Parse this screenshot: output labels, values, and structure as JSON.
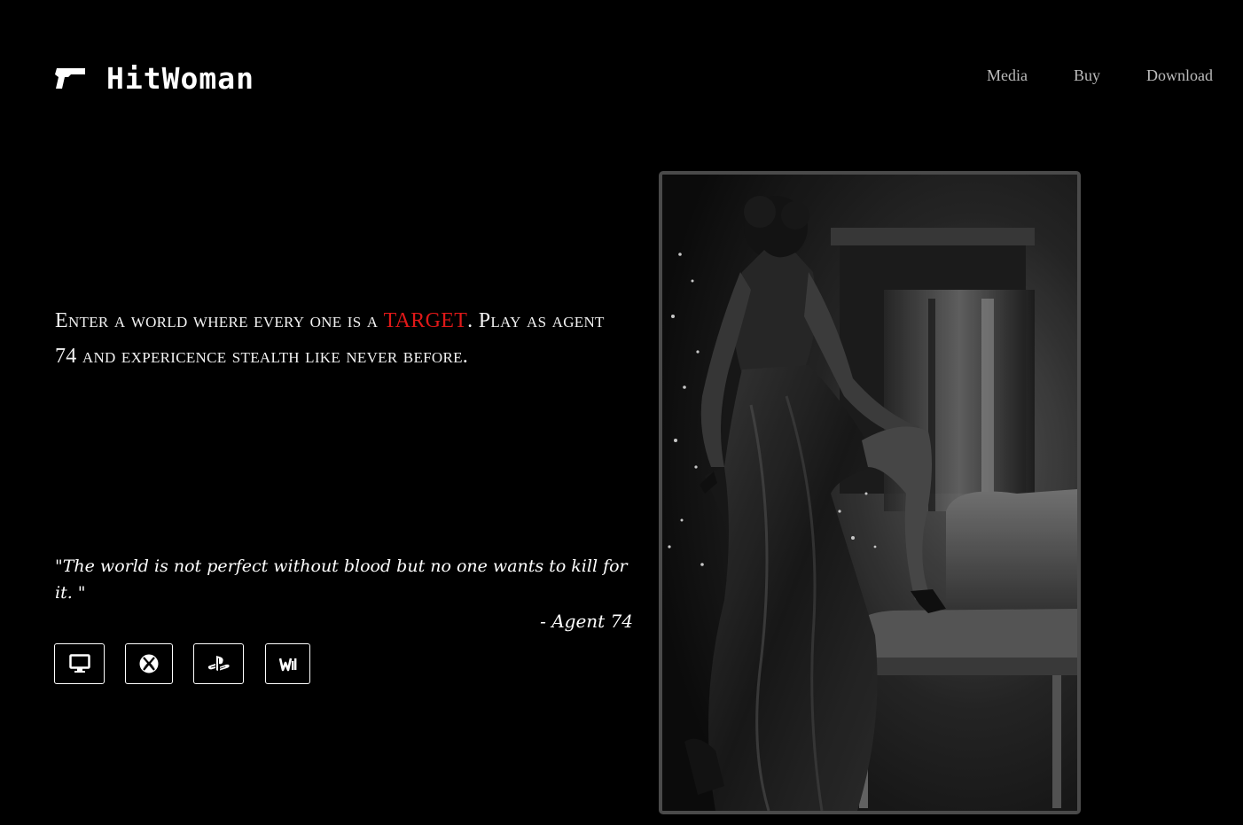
{
  "header": {
    "logo_icon": "pistol-icon",
    "brand": "HitWoman",
    "nav": [
      {
        "label": "Media"
      },
      {
        "label": "Buy"
      },
      {
        "label": "Download"
      }
    ]
  },
  "hero": {
    "tagline_before": "Enter a world where every one is a ",
    "tagline_highlight": "TARGET",
    "tagline_after": ". Play as agent 74 and expericence stealth like never before.",
    "highlight_color": "#e01818",
    "quote": "\"The world is not perfect without blood but no one wants to kill for it. \"",
    "quote_author": "- Agent 74",
    "image_alt": "black-and-white photo of a woman in a satin gown holding a pistol beside an armchair"
  },
  "platforms": [
    {
      "icon": "desktop-icon"
    },
    {
      "icon": "xbox-icon"
    },
    {
      "icon": "playstation-icon"
    },
    {
      "icon": "wii-icon"
    }
  ]
}
